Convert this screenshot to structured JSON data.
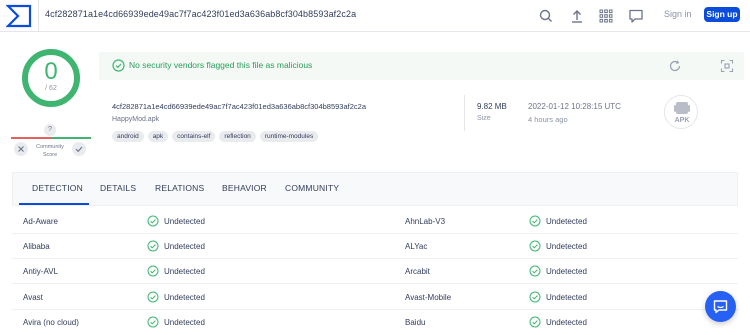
{
  "colors": {
    "accent": "#0b4dda",
    "clean_green": "#3fb571",
    "banner_bg": "#f4f9f5",
    "text": "#313d5a",
    "muted": "#8b93a6"
  },
  "topbar": {
    "search_value": "4cf282871a1e4cd66939ede49ac7f7ac423f01ed3a636ab8cf304b8593af2c2a",
    "icons": [
      "virustotal-logo-icon",
      "search-icon",
      "upload-icon",
      "apps-grid-icon",
      "chat-bubble-icon"
    ],
    "signin_label": "Sign in",
    "signup_label": "Sign up"
  },
  "score": {
    "detections": "0",
    "total": "/ 62",
    "question_mark": "?",
    "community_label": "Community Score"
  },
  "banner": {
    "message": "No security vendors flagged this file as malicious",
    "icons": [
      "check-circle-icon",
      "reanalyze-icon",
      "similar-icon"
    ]
  },
  "file": {
    "hash": "4cf282871a1e4cd66939ede49ac7f7ac423f01ed3a636ab8cf304b8593af2c2a",
    "name": "HappyMod.apk",
    "tags": [
      "android",
      "apk",
      "contains-elf",
      "reflection",
      "runtime-modules"
    ],
    "size_value": "9.82 MB",
    "size_label": "Size",
    "date_value": "2022-01-12 10:28:15 UTC",
    "date_relative": "4 hours ago",
    "type_label": "APK"
  },
  "tabs": [
    "DETECTION",
    "DETAILS",
    "RELATIONS",
    "BEHAVIOR",
    "COMMUNITY"
  ],
  "active_tab": "DETECTION",
  "detections": [
    {
      "left_vendor": "Ad-Aware",
      "left_result": "Undetected",
      "right_vendor": "AhnLab-V3",
      "right_result": "Undetected"
    },
    {
      "left_vendor": "Alibaba",
      "left_result": "Undetected",
      "right_vendor": "ALYac",
      "right_result": "Undetected"
    },
    {
      "left_vendor": "Antiy-AVL",
      "left_result": "Undetected",
      "right_vendor": "Arcabit",
      "right_result": "Undetected"
    },
    {
      "left_vendor": "Avast",
      "left_result": "Undetected",
      "right_vendor": "Avast-Mobile",
      "right_result": "Undetected"
    },
    {
      "left_vendor": "Avira (no cloud)",
      "left_result": "Undetected",
      "right_vendor": "Baidu",
      "right_result": "Undetected"
    }
  ]
}
